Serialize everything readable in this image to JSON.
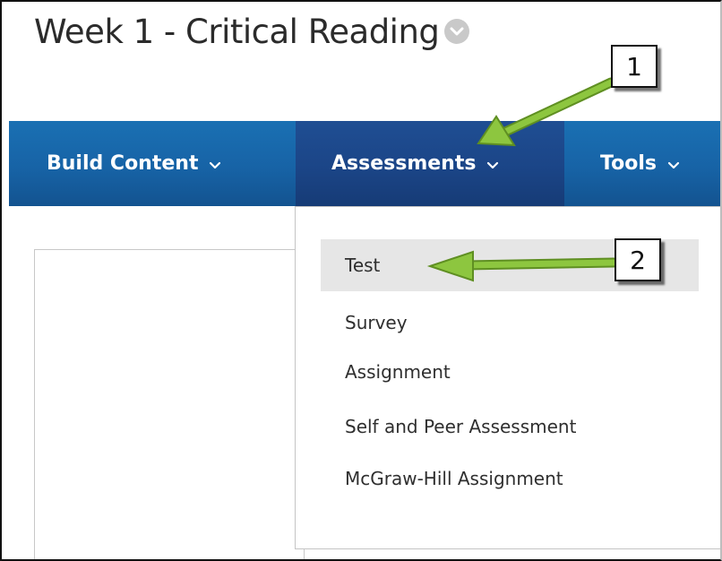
{
  "page": {
    "title": "Week 1 - Critical Reading",
    "title_menu_icon": "chevron-down-circle-icon"
  },
  "navbar": {
    "items": [
      {
        "label": "Build Content",
        "icon": "chevron-down-icon"
      },
      {
        "label": "Assessments",
        "icon": "chevron-down-icon",
        "active": true
      },
      {
        "label": "Tools",
        "icon": "chevron-down-icon"
      }
    ]
  },
  "dropdown": {
    "items": [
      {
        "label": "Test",
        "highlighted": true
      },
      {
        "label": "Survey"
      },
      {
        "label": "Assignment"
      },
      {
        "label": "Self and Peer Assessment"
      },
      {
        "label": "McGraw-Hill Assignment"
      }
    ]
  },
  "annotations": {
    "callouts": [
      "1",
      "2"
    ],
    "arrow_color": "#8dc63f"
  },
  "colors": {
    "navbar": "#1763a6",
    "navbar_active": "#1b4587",
    "highlight": "#e6e6e6"
  }
}
